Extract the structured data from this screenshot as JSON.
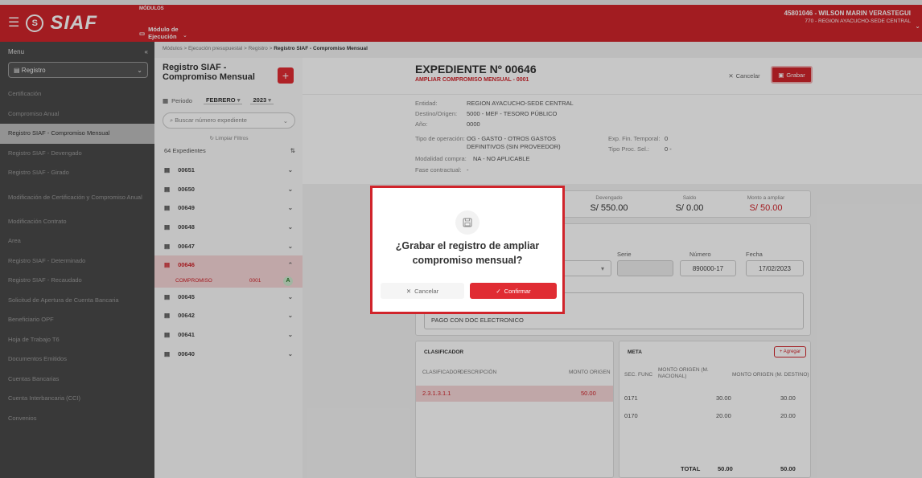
{
  "app": {
    "name": "SIAF",
    "logo_mark": "S",
    "menu_icon": "hamburger-icon"
  },
  "modules": {
    "label": "MÓDULOS",
    "value": "Módulo de Ejecución"
  },
  "user": {
    "name": "45801046 - WILSON MARIN VERASTEGUI",
    "org": "770 - REGION AYACUCHO-SEDE CENTRAL"
  },
  "sidebar": {
    "title": "Menu",
    "collapse": "«",
    "select": "Registro",
    "items": [
      {
        "label": "Certificación"
      },
      {
        "label": "Compromiso Anual"
      },
      {
        "label": "Registro SIAF - Compromiso Mensual"
      },
      {
        "label": "Registro SIAF - Devengado"
      },
      {
        "label": "Registro SIAF - Girado"
      },
      {
        "label": "Modificación de Certificación y Compromiso Anual"
      },
      {
        "label": "Modificación Contrato"
      },
      {
        "label": "Area"
      },
      {
        "label": "Registro SIAF - Determinado"
      },
      {
        "label": "Registro SIAF - Recaudado"
      },
      {
        "label": "Solicitud de Apertura de Cuenta Bancaria"
      },
      {
        "label": "Beneficiario OPF"
      },
      {
        "label": "Hoja de Trabajo T6"
      },
      {
        "label": "Documentos Emitidos"
      },
      {
        "label": "Cuentas Bancarias"
      },
      {
        "label": "Cuenta Interbancaria (CCI)"
      },
      {
        "label": "Convenios"
      }
    ]
  },
  "breadcrumb": {
    "path": "Módulos > Ejecución presupuestal > Registro > ",
    "current": "Registro SIAF - Compromiso Mensual"
  },
  "left_panel": {
    "title": "Registro SIAF - Compromiso Mensual",
    "add": "+",
    "period_label": "Periodo",
    "month": "FEBRERO",
    "year": "2023",
    "search_placeholder": "Buscar número expediente",
    "clear_filters": "Limpiar Filtros",
    "count": "64 Expedientes",
    "exp": {
      "e0": "00651",
      "e1": "00650",
      "e2": "00649",
      "e3": "00648",
      "e4": "00647",
      "e5": "00646",
      "e6": "00645",
      "e7": "00642",
      "e8": "00641",
      "e9": "00640"
    },
    "sub": {
      "type": "COMPROMISO",
      "num": "0001",
      "badge": "A"
    }
  },
  "header": {
    "title": "EXPEDIENTE Nº 00646",
    "subtitle": "AMPLIAR COMPROMISO MENSUAL - 0001",
    "cancel": "Cancelar",
    "save": "Grabar"
  },
  "info": {
    "entidad_k": "Entidad:",
    "entidad_v": "REGION AYACUCHO-SEDE CENTRAL",
    "destino_k": "Destino/Origen:",
    "destino_v": "5000 - MEF - TESORO PÚBLICO",
    "anio_k": "Año:",
    "anio_v": "0000",
    "tipo_k": "Tipo de operación:",
    "tipo_v": "OG - GASTO - OTROS GASTOS DEFINITIVOS (SIN PROVEEDOR)",
    "fin_k": "Exp. Fin. Temporal:",
    "fin_v": "0",
    "proc_k": "Tipo Proc. Sel.:",
    "proc_v": "0 -",
    "mod_k": "Modalidad compra:",
    "mod_v": "NA - NO APLICABLE",
    "fase_k": "Fase contractual:",
    "fase_v": "-"
  },
  "amounts": {
    "dev_l": "Devengado",
    "dev_v": "S/ 550.00",
    "saldo_l": "Saldo",
    "saldo_v": "S/ 0.00",
    "amp_l": "Monto a ampliar",
    "amp_v": "S/ 50.00"
  },
  "doc": {
    "serie_l": "Serie",
    "num_l": "Número",
    "num_v": "890000-17",
    "fecha_l": "Fecha",
    "fecha_v": "17/02/2023",
    "obs": "PAGO CON DOC ELECTRONICO"
  },
  "clasificador": {
    "title": "CLASIFICADOR",
    "h1": "CLASIFICADOR",
    "h2": "DESCRIPCIÓN",
    "h3": "MONTO ORIGEN",
    "r1_code": "2.3.1.3.1.1",
    "r1_monto": "50.00"
  },
  "meta": {
    "title": "META",
    "add": "+ Agregar",
    "h1": "SEC. FUNC",
    "h2": "MONTO ORIGEN (M. NACIONAL)",
    "h3": "MONTO ORIGEN (M. DESTINO)",
    "r1_sec": "0171",
    "r1_a": "30.00",
    "r1_b": "30.00",
    "r2_sec": "0170",
    "r2_a": "20.00",
    "r2_b": "20.00",
    "total_l": "TOTAL",
    "total_a": "50.00",
    "total_b": "50.00"
  },
  "modal": {
    "question": "¿Grabar el registro de ampliar compromiso mensual?",
    "cancel": "Cancelar",
    "confirm": "Confirmar"
  },
  "colors": {
    "brand": "#d0242b",
    "sidebar": "#4a4a4a"
  }
}
